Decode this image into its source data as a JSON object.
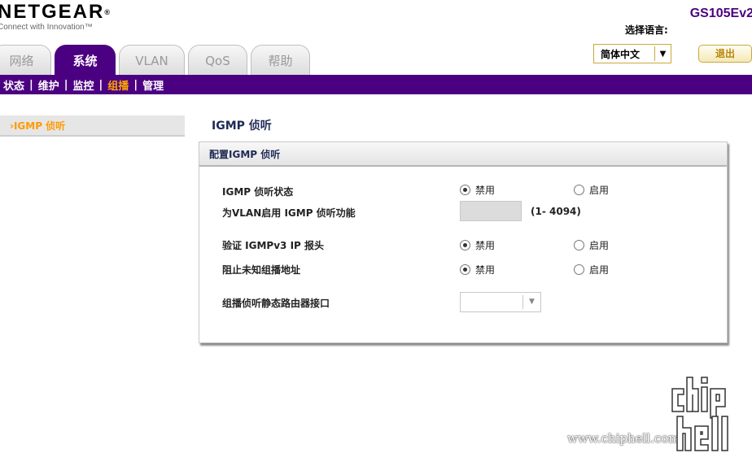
{
  "header": {
    "logo_text": "NETGEAR",
    "logo_reg": "®",
    "logo_tagline": "Connect with Innovation™",
    "model": "GS105Ev2",
    "language_label": "选择语言:",
    "language_value": "简体中文",
    "logout_label": "退出"
  },
  "tabs": [
    {
      "label": "网络",
      "active": false
    },
    {
      "label": "系统",
      "active": true
    },
    {
      "label": "VLAN",
      "active": false
    },
    {
      "label": "QoS",
      "active": false
    },
    {
      "label": "帮助",
      "active": false
    }
  ],
  "subnav": [
    {
      "label": "状态",
      "active": false
    },
    {
      "label": "维护",
      "active": false
    },
    {
      "label": "监控",
      "active": false
    },
    {
      "label": "组播",
      "active": true
    },
    {
      "label": "管理",
      "active": false
    }
  ],
  "sidebar": {
    "items": [
      {
        "label": "›IGMP 侦听",
        "active": true
      }
    ]
  },
  "main": {
    "title": "IGMP 侦听",
    "panel_title": "配置IGMP 侦听",
    "disable_label": "禁用",
    "enable_label": "启用",
    "rows": {
      "igmp_status": {
        "label": "IGMP 侦听状态",
        "selected": "禁用"
      },
      "vlan_enable": {
        "label": "为VLAN启用 IGMP 侦听功能",
        "value": "",
        "range": "(1- 4094)"
      },
      "validate_ipv3": {
        "label": "验证 IGMPv3 IP 报头",
        "selected": "禁用"
      },
      "block_unknown": {
        "label": "阻止未知组播地址",
        "selected": "禁用"
      },
      "router_port": {
        "label": "组播侦听静态路由器接口",
        "value": ""
      }
    }
  },
  "watermark": {
    "url": "www.chiphell.com",
    "logo_text": "chip hell"
  },
  "colors": {
    "brand_purple": "#4b0082",
    "active_orange": "#ffa500",
    "title_navy": "#1f2a55"
  }
}
